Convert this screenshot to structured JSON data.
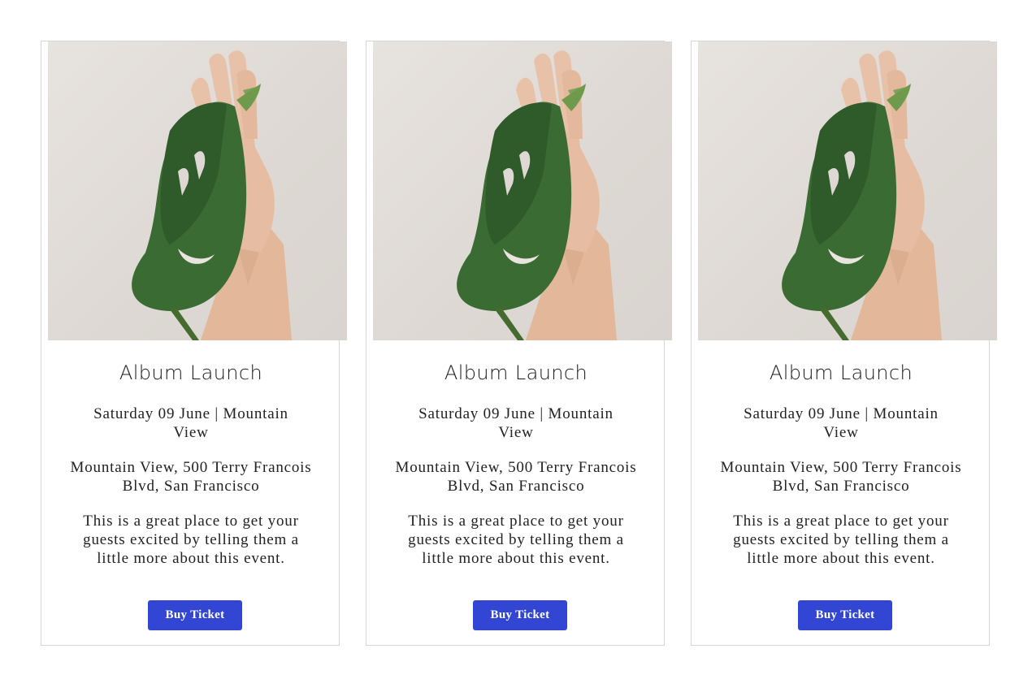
{
  "events": [
    {
      "title": "Album Launch",
      "date_location": "Saturday 09 June | Mountain View",
      "address": "Mountain View, 500 Terry Francois Blvd, San Francisco",
      "description": "This is a great place to get your guests excited by telling them a little more about this event.",
      "button_label": "Buy Ticket"
    },
    {
      "title": "Album Launch",
      "date_location": "Saturday 09 June | Mountain View",
      "address": "Mountain View, 500 Terry Francois Blvd, San Francisco",
      "description": "This is a great place to get your guests excited by telling them a little more about this event.",
      "button_label": "Buy Ticket"
    },
    {
      "title": "Album Launch",
      "date_location": "Saturday 09 June | Mountain View",
      "address": "Mountain View, 500 Terry Francois Blvd, San Francisco",
      "description": "This is a great place to get your guests excited by telling them a little more about this event.",
      "button_label": "Buy Ticket"
    }
  ],
  "colors": {
    "button_bg": "#3346d3",
    "card_border": "#d6d6d6",
    "leaf": "#3a6b33",
    "skin": "#e2b79a"
  }
}
